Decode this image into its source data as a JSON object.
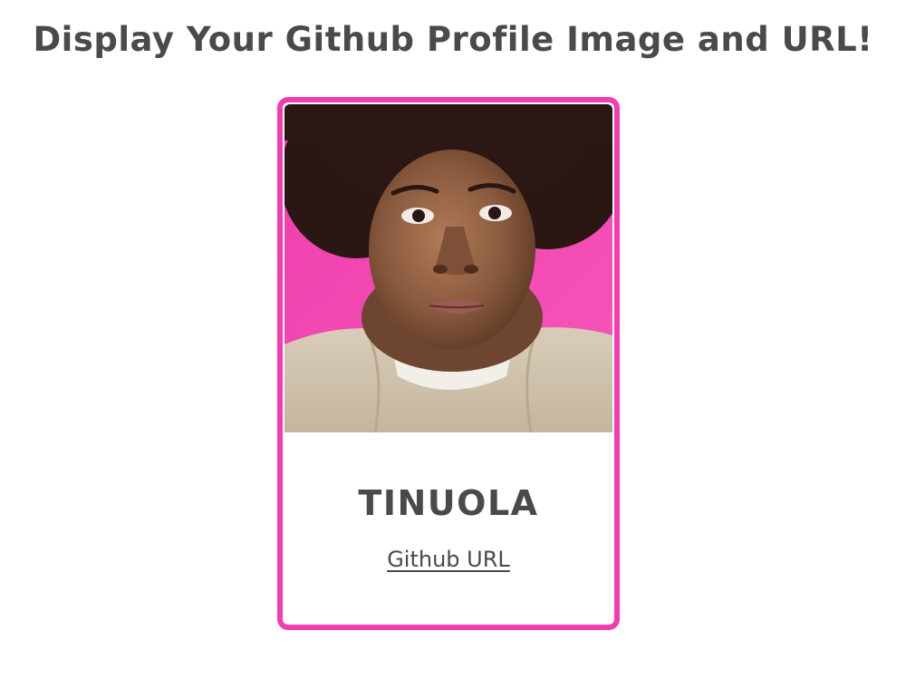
{
  "page": {
    "title": "Display Your Github Profile Image and URL!"
  },
  "profile": {
    "name": "TINUOLA",
    "link_label": "Github URL",
    "photo_icon": "profile-photo",
    "colors": {
      "accent": "#f53bb1",
      "photo_background": "#f03fae",
      "text": "#4a4a4a"
    }
  }
}
